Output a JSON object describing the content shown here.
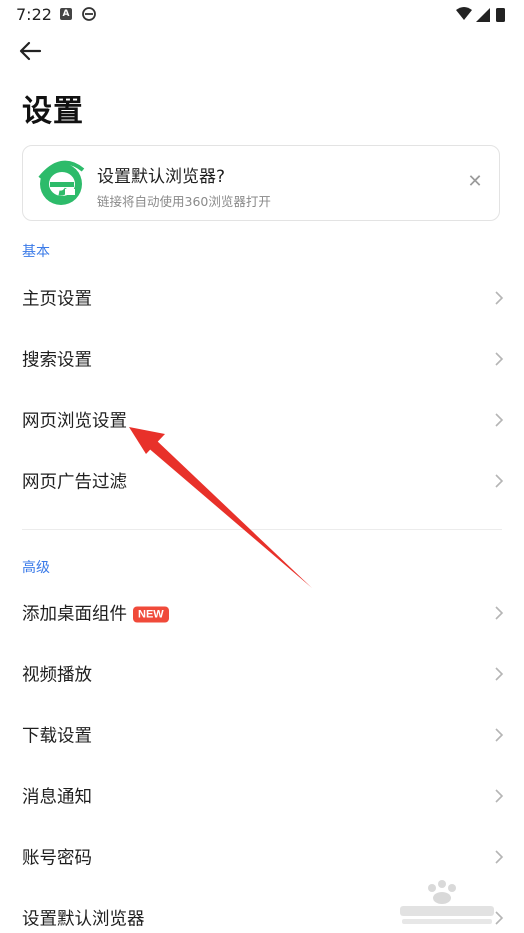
{
  "status_bar": {
    "time": "7:22",
    "notif_a": "A"
  },
  "header": {
    "title": "设置"
  },
  "banner": {
    "title": "设置默认浏览器?",
    "subtitle": "链接将自动使用360浏览器打开"
  },
  "sections": {
    "basic": {
      "label": "基本",
      "items": [
        "主页设置",
        "搜索设置",
        "网页浏览设置",
        "网页广告过滤"
      ]
    },
    "advanced": {
      "label": "高级",
      "items": [
        "添加桌面组件",
        "视频播放",
        "下载设置",
        "消息通知",
        "账号密码",
        "设置默认浏览器"
      ],
      "badge": "NEW"
    }
  },
  "colors": {
    "accent_blue": "#3a7ae8",
    "badge_red": "#f04a3a",
    "logo_green": "#2dbb6a",
    "annotation_red": "#e8312a"
  },
  "icons": {
    "back": "arrow-left-icon",
    "close": "close-icon",
    "chevron": "chevron-right-icon",
    "logo": "browser-360-logo"
  }
}
